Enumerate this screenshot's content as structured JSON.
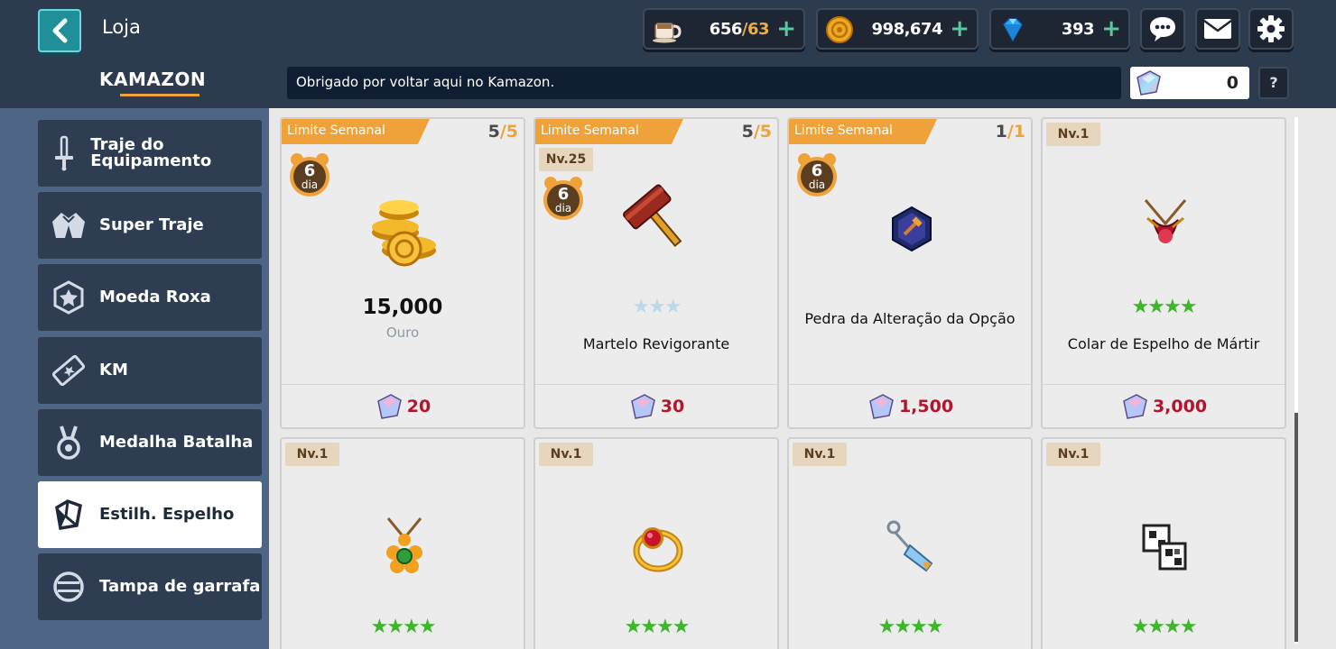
{
  "header": {
    "title": "Loja",
    "brand": "KAMAZON",
    "notice": "Obrigado por voltar aqui no Kamazon.",
    "help_label": "?",
    "resources": [
      {
        "icon": "coffee-cup-icon",
        "value": "656",
        "max": "/63"
      },
      {
        "icon": "gold-coin-icon",
        "value": "998,674"
      },
      {
        "icon": "diamond-icon",
        "value": "393"
      }
    ],
    "plus_label": "+",
    "mirror_gem_count": "0"
  },
  "sidebar": {
    "items": [
      {
        "label": "Traje do Equipamento",
        "icon": "sword-icon",
        "active": false
      },
      {
        "label": "Super Traje",
        "icon": "super-suit-icon",
        "active": false
      },
      {
        "label": "Moeda Roxa",
        "icon": "purple-coin-icon",
        "active": false
      },
      {
        "label": "KM",
        "icon": "km-ticket-icon",
        "active": false
      },
      {
        "label": "Medalha Batalha",
        "icon": "medal-icon",
        "active": false
      },
      {
        "label": "Estilh. Espelho",
        "icon": "mirror-shard-icon",
        "active": true
      },
      {
        "label": "Tampa de garrafa",
        "icon": "bottle-cap-icon",
        "active": false
      }
    ]
  },
  "shop": {
    "limit_label": "Limite Semanal",
    "days_unit": "dia",
    "cards": [
      {
        "limit": "5",
        "limit_max": "/5",
        "days": "6",
        "amount": "15,000",
        "currency": "Ouro",
        "price": "20",
        "icon": "gold-coins-icon"
      },
      {
        "limit": "5",
        "limit_max": "/5",
        "level": "Nv.25",
        "days": "6",
        "stars": "★★★",
        "name": "Martelo Revigorante",
        "price": "30",
        "icon": "hammer-icon"
      },
      {
        "limit": "1",
        "limit_max": "/1",
        "days": "6",
        "name": "Pedra da Alteração da Opção",
        "price": "1,500",
        "icon": "option-stone-icon"
      },
      {
        "level": "Nv.1",
        "stars": "★★★★",
        "name": "Colar de Espelho de Mártir",
        "price": "3,000",
        "icon": "ruby-necklace-icon"
      },
      {
        "level": "Nv.1",
        "stars": "★★★★",
        "icon": "flower-necklace-icon"
      },
      {
        "level": "Nv.1",
        "stars": "★★★★",
        "icon": "ruby-ring-icon"
      },
      {
        "level": "Nv.1",
        "stars": "★★★★",
        "icon": "crystal-earring-icon"
      },
      {
        "level": "Nv.1",
        "stars": "★★★★",
        "icon": "qr-box-icon"
      }
    ]
  },
  "colors": {
    "header_bg": "#2d3b4e",
    "sidebar_bg": "#4f6585",
    "accent_orange": "#f0a23a",
    "price_red": "#b3132b",
    "teal_button": "#1f8f9a"
  }
}
